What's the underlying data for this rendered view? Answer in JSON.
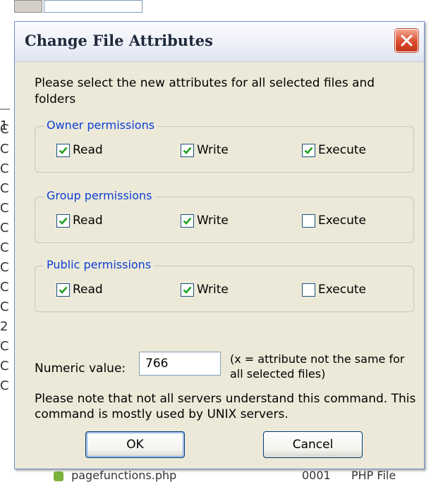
{
  "background": {
    "side_letters": [
      "C",
      "C",
      "C",
      "C",
      "C",
      "C",
      "C",
      "C",
      "C",
      "C",
      "2",
      "C",
      "C",
      "C"
    ],
    "side_fragment": "1",
    "bottom_row": {
      "filename": "pagefunctions.php",
      "col2": "0001",
      "col3": "PHP File"
    }
  },
  "dialog": {
    "title": "Change File Attributes",
    "intro": "Please select the new attributes for all selected files and folders",
    "groups": [
      {
        "legend": "Owner permissions",
        "checkboxes": [
          {
            "label": "Read",
            "checked": true
          },
          {
            "label": "Write",
            "checked": true
          },
          {
            "label": "Execute",
            "checked": true
          }
        ]
      },
      {
        "legend": "Group permissions",
        "checkboxes": [
          {
            "label": "Read",
            "checked": true
          },
          {
            "label": "Write",
            "checked": true
          },
          {
            "label": "Execute",
            "checked": false
          }
        ]
      },
      {
        "legend": "Public permissions",
        "checkboxes": [
          {
            "label": "Read",
            "checked": true
          },
          {
            "label": "Write",
            "checked": true
          },
          {
            "label": "Execute",
            "checked": false
          }
        ]
      }
    ],
    "numeric_label": "Numeric value:",
    "numeric_value": "766",
    "numeric_note": "(x = attribute not the same for all selected files)",
    "note": "Please note that not all servers understand this command. This command is mostly used by UNIX servers.",
    "ok_label": "OK",
    "cancel_label": "Cancel"
  },
  "colors": {
    "legend": "#0b3fd4",
    "dialog_bg": "#ece9d8",
    "close_button": "#d8492a",
    "check_mark": "#21a121"
  }
}
